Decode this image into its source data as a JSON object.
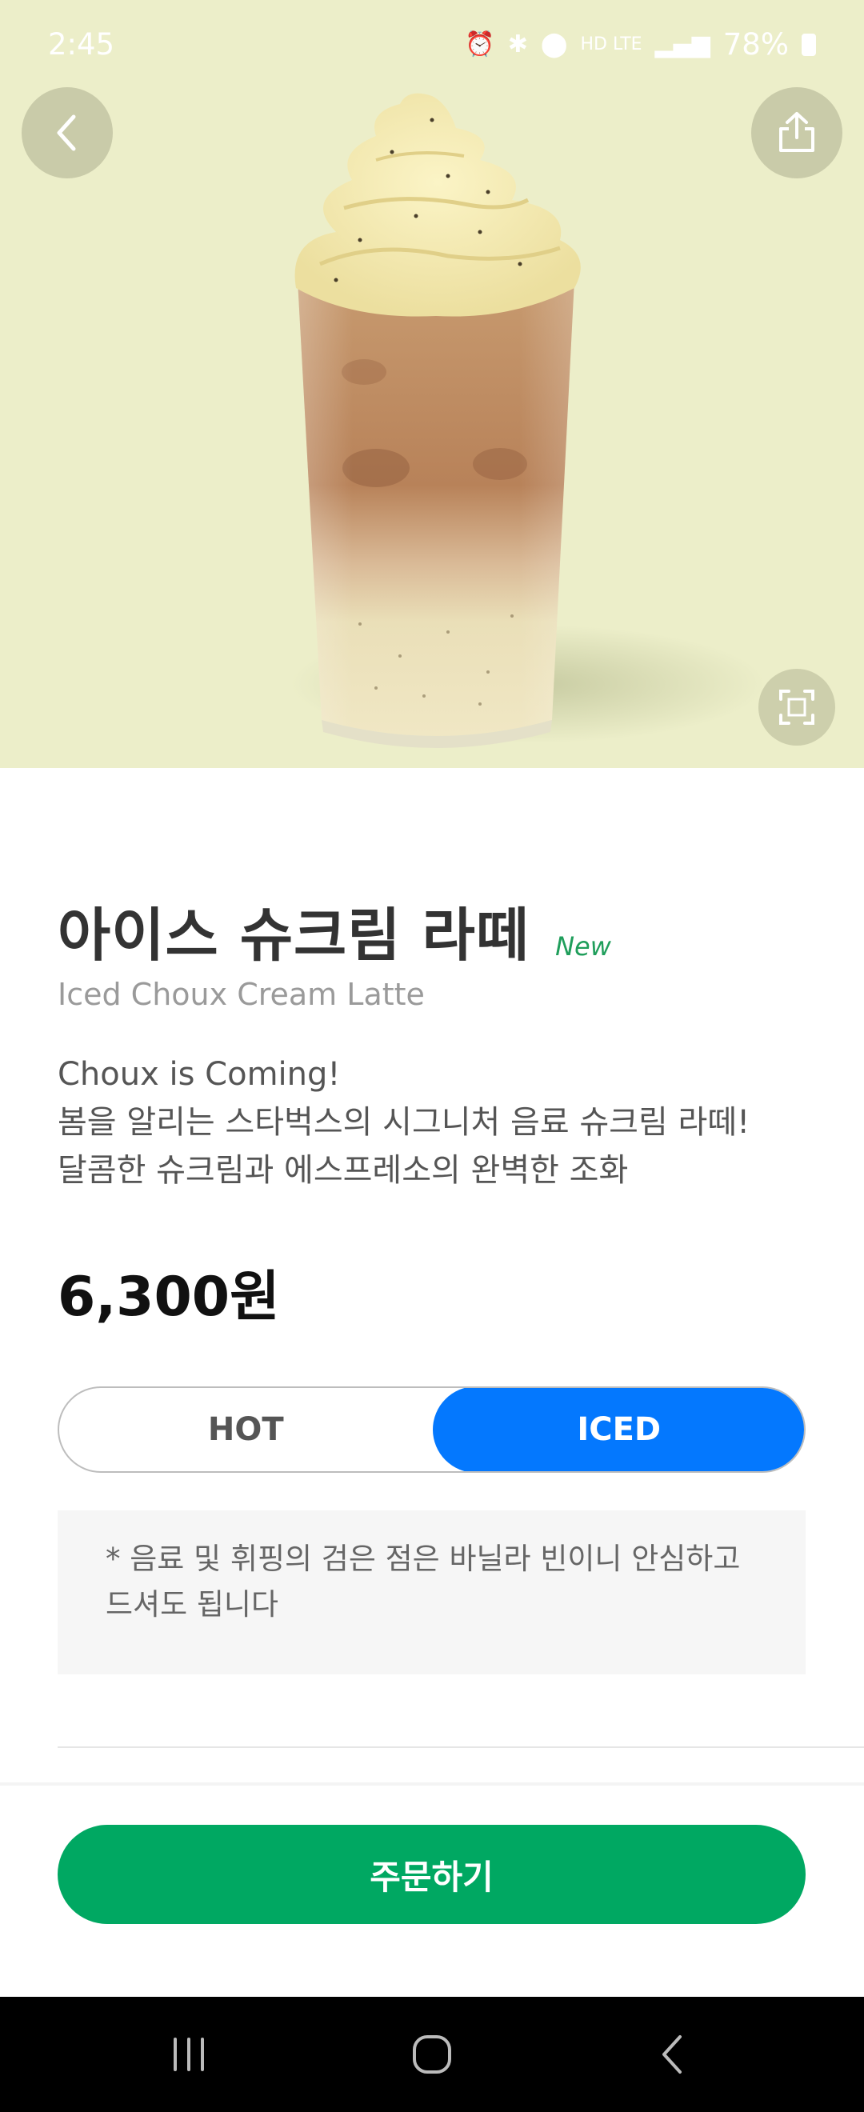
{
  "status_bar": {
    "time": "2:45",
    "network": "HD LTE",
    "battery": "78%"
  },
  "hero": {
    "background_color": "#eceec9",
    "image_subject": "iced-choux-cream-latte-drink"
  },
  "product": {
    "name_ko": "아이스 슈크림 라떼",
    "badge": "New",
    "name_en": "Iced Choux Cream Latte",
    "description_lines": [
      "Choux is Coming!",
      "봄을 알리는 스타벅스의 시그니처 음료 슈크림 라떼!",
      "달콤한 슈크림과 에스프레소의 완벽한 조화"
    ],
    "price": "6,300원"
  },
  "temperature_toggle": {
    "options": [
      "HOT",
      "ICED"
    ],
    "selected": "ICED",
    "active_color": "#0478fe"
  },
  "notice": {
    "line1": "* 음료 및 휘핑의 검은 점은 바닐라 빈이니 안심하고",
    "line2": "드셔도 됩니다"
  },
  "order_button": {
    "label": "주문하기",
    "color": "#00a862"
  },
  "icons": [
    "back-icon",
    "share-icon",
    "zoom-icon",
    "recent-apps-icon",
    "home-icon",
    "nav-back-icon"
  ]
}
